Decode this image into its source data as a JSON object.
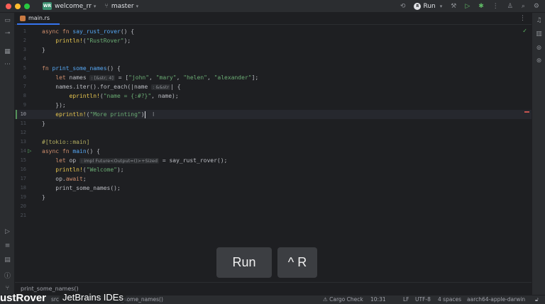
{
  "titlebar": {
    "project_badge": "WR",
    "project_name": "welcome_rr",
    "branch": "master",
    "run_label": "Run"
  },
  "tab": {
    "filename": "main.rs"
  },
  "editor": {
    "lines": [
      {
        "num": "1"
      },
      {
        "num": "2"
      },
      {
        "num": "3"
      },
      {
        "num": "4"
      },
      {
        "num": "5"
      },
      {
        "num": "6"
      },
      {
        "num": "7"
      },
      {
        "num": "8"
      },
      {
        "num": "9"
      },
      {
        "num": "10"
      },
      {
        "num": "11"
      },
      {
        "num": "12"
      },
      {
        "num": "13"
      },
      {
        "num": "14"
      },
      {
        "num": "15"
      },
      {
        "num": "16"
      },
      {
        "num": "17"
      },
      {
        "num": "18"
      },
      {
        "num": "19"
      },
      {
        "num": "20"
      },
      {
        "num": "21"
      }
    ],
    "code": {
      "l1_async": "async",
      "l1_fn": "fn",
      "l1_name": "say_rust_rover",
      "l1_rest": "() {",
      "l2_macro": "println!",
      "l2_open": "(",
      "l2_str": "\"RustRover\"",
      "l2_close": ");",
      "l3": "}",
      "l5_fn": "fn",
      "l5_name": "print_some_names",
      "l5_rest": "() {",
      "l6_let": "let",
      "l6_var": "names",
      "l6_hint": ": [&str; 4]",
      "l6_eq": " = [",
      "l6_s1": "\"john\"",
      "l6_s2": "\"mary\"",
      "l6_s3": "\"helen\"",
      "l6_s4": "\"alexander\"",
      "l6_end": "];",
      "l7_a": "names.iter().for_each(|name",
      "l7_hint": ": &&str",
      "l7_b": "| {",
      "l8_macro": "eprintln!",
      "l8_open": "(",
      "l8_str": "\"name = {:#?}\"",
      "l8_close": ", name);",
      "l9": "});",
      "l10_macro": "eprintln!",
      "l10_open": "(",
      "l10_str": "\"More printing\"",
      "l10_close": ")",
      "l11": "}",
      "l13_attr": "#[tokio::main]",
      "l14_async": "async",
      "l14_fn": "fn",
      "l14_name": "main",
      "l14_rest": "() {",
      "l15_let": "let",
      "l15_var": "op",
      "l15_hint": ": impl Future<Output=()>+Sized",
      "l15_rest": " = say_rust_rover();",
      "l16_macro": "println!",
      "l16_open": "(",
      "l16_str": "\"Welcome\"",
      "l16_close": ");",
      "l17_a": "op.",
      "l17_kw": "await",
      "l17_b": ";",
      "l18": "print_some_names();",
      "l19": "}"
    }
  },
  "breadcrumb": {
    "text": "print_some_names()"
  },
  "statusbar": {
    "cargo_check": "Cargo Check",
    "position": "10:31",
    "line_sep": "LF",
    "encoding": "UTF-8",
    "indent": "4 spaces",
    "target": "aarch64-apple-darwin",
    "path_fragment_1": "src",
    "path_fragment_2": "t_some_names()"
  },
  "overlays": {
    "key_action": "Run",
    "key_combo": "^ R",
    "watermark_left": "ustRover",
    "watermark_right": "JetBrains IDEs"
  },
  "colors": {
    "background": "#1e1f22",
    "panel": "#2b2d30",
    "keyword": "#cf8e6d",
    "function": "#56a8f5",
    "macro": "#e6c54f",
    "string": "#6aab73",
    "accent": "#3574f0",
    "success": "#5fb865"
  }
}
